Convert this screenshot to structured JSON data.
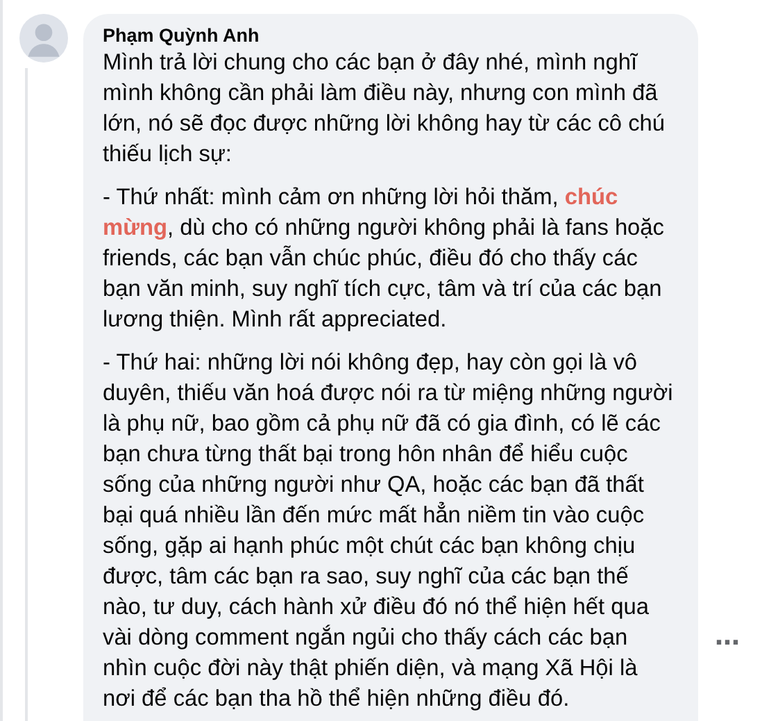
{
  "comment": {
    "author": "Phạm Quỳnh Anh",
    "paragraphs": [
      "Mình trả lời chung cho các bạn ở đây nhé, mình nghĩ mình không cần phải làm điều này, nhưng con mình đã lớn, nó sẽ đọc được những lời không hay từ các cô chú thiếu lịch sự:",
      "- Thứ nhất: mình cảm ơn những lời hỏi thăm, **chúc mừng**, dù cho có những người không phải là fans hoặc friends, các bạn vẫn chúc phúc, điều đó cho thấy các bạn văn minh, suy nghĩ tích cực, tâm và trí của các bạn lương thiện. Mình rất appreciated.",
      "- Thứ hai: những lời nói không đẹp, hay còn gọi là vô duyên, thiếu văn hoá được nói ra từ miệng những người là phụ nữ, bao gồm cả phụ nữ đã có gia đình, có lẽ các bạn chưa từng thất bại trong hôn nhân để hiểu cuộc sống của những người như QA, hoặc các bạn đã thất bại quá nhiều lần đến mức mất hẳn niềm tin vào cuộc sống, gặp ai hạnh phúc một chút các bạn không chịu được, tâm các bạn ra sao, suy nghĩ của các bạn thế nào, tư duy, cách hành xử điều đó nó thể hiện hết qua vài dòng comment ngắn ngủi cho thấy cách các bạn nhìn cuộc đời này thật phiến diện, và mạng Xã Hội là nơi để các bạn tha hồ thể hiện những điều đó."
    ],
    "more_button": "…"
  }
}
